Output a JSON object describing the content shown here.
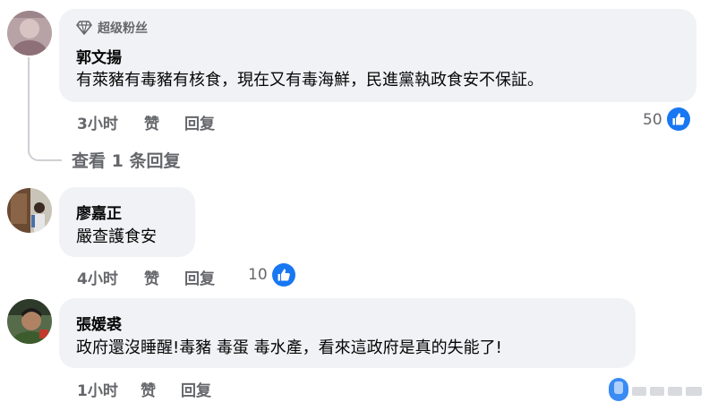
{
  "comments": [
    {
      "badge": "超级粉丝",
      "author": "郭文揚",
      "text": "有萊豬有毒豬有核食，現在又有毒海鮮，民進黨執政食安不保証。",
      "time": "3小时",
      "like_label": "赞",
      "reply_label": "回复",
      "reaction_count": "50"
    },
    {
      "author": "廖嘉正",
      "text": "嚴查護食安",
      "time": "4小时",
      "like_label": "赞",
      "reply_label": "回复",
      "reaction_count": "10"
    },
    {
      "author": "張媛裘",
      "text": "政府還沒睡醒!毒豬 毒蛋 毒水產，看來這政府是真的失能了!",
      "time": "1小时",
      "like_label": "赞",
      "reply_label": "回复"
    }
  ],
  "view_replies_label": "查看 1 条回复",
  "colors": {
    "bubble": "#f0f2f5",
    "muted_text": "#65676b",
    "like_blue": "#1877f2",
    "thread_line": "#ced0d4"
  },
  "icons": {
    "badge": "diamond-icon",
    "reaction": "thumbs-up-icon"
  }
}
